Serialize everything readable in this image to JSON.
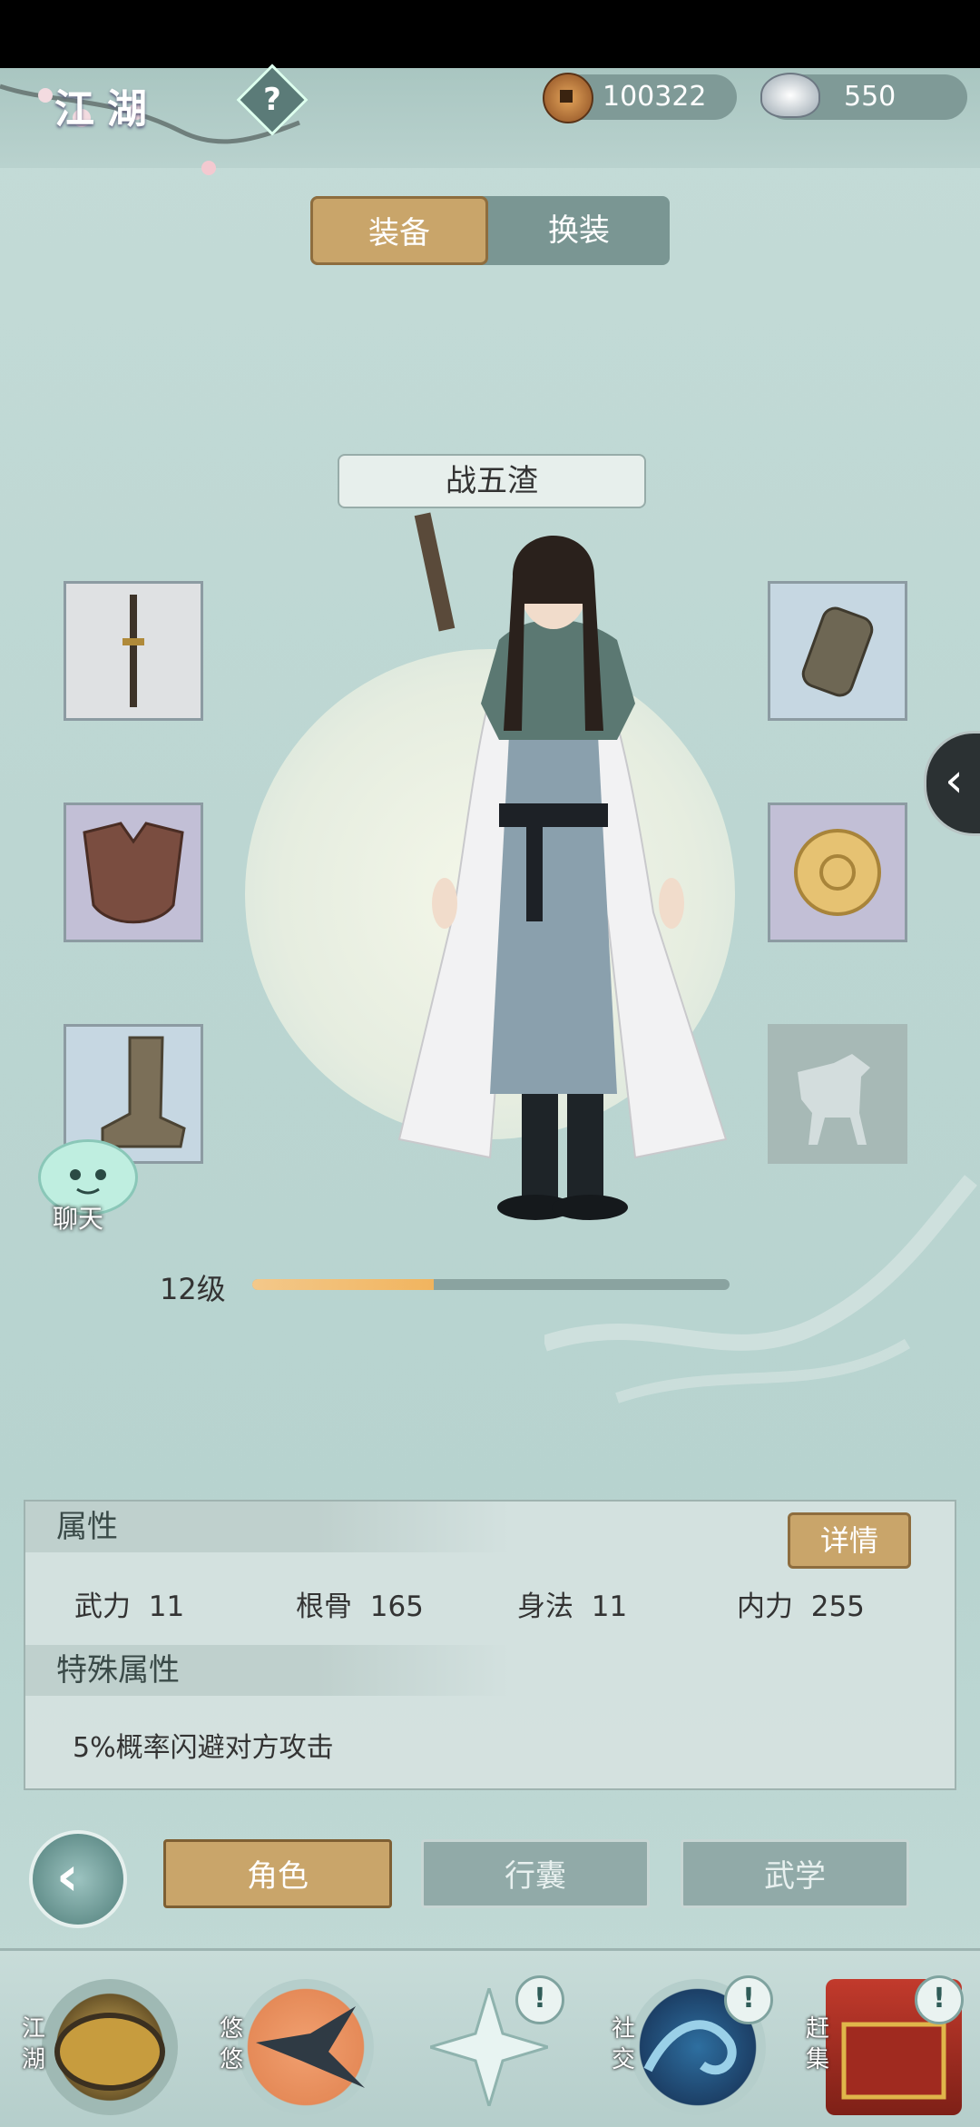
{
  "header": {
    "title": "江湖",
    "help_symbol": "?"
  },
  "currency": {
    "copper": "100322",
    "silver": "550"
  },
  "tabs": {
    "equip": "装备",
    "outfit": "换装"
  },
  "character": {
    "name": "战五渣",
    "level": "12级",
    "exp_progress_fraction": 0.38
  },
  "chat": {
    "label": "聊天"
  },
  "attributes": {
    "heading": "属性",
    "details_button": "详情",
    "stats": [
      {
        "label": "武力",
        "value": "11"
      },
      {
        "label": "根骨",
        "value": "165"
      },
      {
        "label": "身法",
        "value": "11"
      },
      {
        "label": "内力",
        "value": "255"
      }
    ],
    "special_heading": "特殊属性",
    "special_text": "5%概率闪避对方攻击"
  },
  "nav": {
    "role": "角色",
    "bag": "行囊",
    "martial": "武学"
  },
  "dock": {
    "jianghu": "江湖",
    "youyou": "悠悠",
    "social": "社交",
    "market": "赶集",
    "alert_symbol": "!"
  },
  "colors": {
    "accent_gold": "#c9a56a",
    "teal": "#7a9693",
    "bg": "#bcd6d2"
  }
}
